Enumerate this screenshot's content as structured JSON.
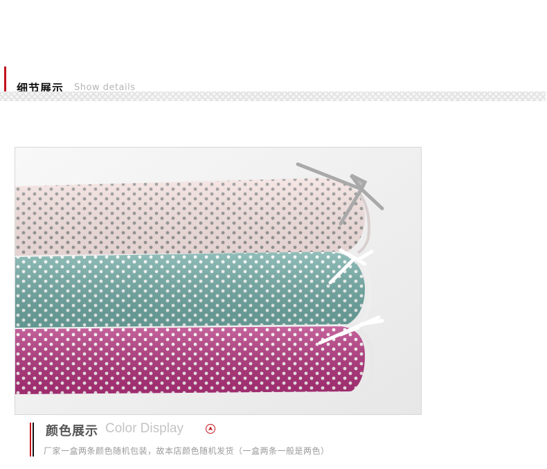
{
  "detail_section": {
    "title": "细节展示",
    "subtitle": "Show details"
  },
  "photo": {
    "subject": "three folded polka-dot fabrics with ribbon bows",
    "colors": {
      "top_fabric": "#f5e3e1",
      "top_dots": "#9a9a9a",
      "middle_fabric": "#6faaa4",
      "bottom_fabric": "#b3327d",
      "dots_white": "#ffffff",
      "background": "#f4f4f4"
    }
  },
  "color_section": {
    "title": "颜色展示",
    "subtitle": "Color Display",
    "icon": "up-arrow-circle-icon",
    "note": "厂家一盒两条颜色随机包装，故本店颜色随机发货（一盒两条一般是两色）"
  },
  "accents": {
    "red": "#c1121c",
    "black": "#111111"
  }
}
